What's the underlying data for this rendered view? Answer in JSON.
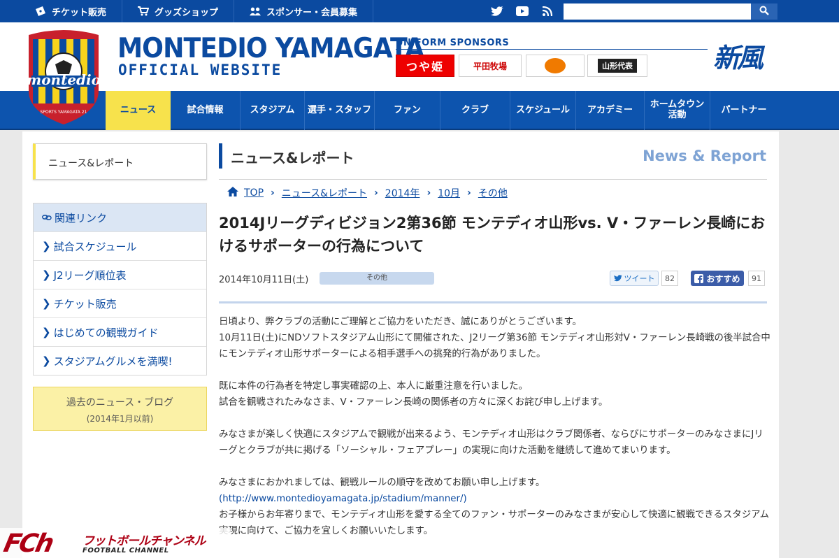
{
  "topbar": {
    "items": [
      {
        "label": "チケット販売",
        "icon": "ticket-icon"
      },
      {
        "label": "グッズショップ",
        "icon": "cart-icon"
      },
      {
        "label": "スポンサー・会員募集",
        "icon": "people-icon"
      }
    ],
    "social": [
      "twitter-icon",
      "youtube-icon",
      "rss-icon"
    ],
    "search_value": ""
  },
  "header": {
    "title": "MONTEDIO YAMAGATA",
    "subtitle": "OFFICIAL WEBSITE",
    "sponsors_heading": "UNIFORM SPONSORS",
    "sponsors": [
      "つや姫",
      "平田牧場",
      "",
      "山形代表"
    ],
    "brush_text": "新風"
  },
  "nav": {
    "items": [
      "ニュース",
      "試合情報",
      "スタジアム",
      "選手・スタッフ",
      "ファン",
      "クラブ",
      "スケジュール",
      "アカデミー",
      "ホームタウン\n活動",
      "パートナー"
    ]
  },
  "sidebar": {
    "active": "ニュース&レポート",
    "links_heading": "関連リンク",
    "links": [
      "試合スケジュール",
      "J2リーグ順位表",
      "チケット販売",
      "はじめての観戦ガイド",
      "スタジアムグルメを満喫!"
    ],
    "archive_line1": "過去のニュース・ブログ",
    "archive_line2": "(2014年1月以前)"
  },
  "section": {
    "title": "ニュース&レポート",
    "title_en": "News & Report"
  },
  "breadcrumb": [
    "TOP",
    "ニュース&レポート",
    "2014年",
    "10月",
    "その他"
  ],
  "article": {
    "title": "2014Jリーグディビジョン2第36節 モンテディオ山形vs. V・ファーレン長崎におけるサポーターの行為について",
    "date": "2014年10月11日(土)",
    "category": "その他",
    "tweet_label": "ツイート",
    "tweet_count": "82",
    "fb_label": "おすすめ",
    "fb_count": "91",
    "p1": "日頃より、弊クラブの活動にご理解とご協力をいただき、誠にありがとうございます。\n10月11日(土)にNDソフトスタジアム山形にて開催された、J2リーグ第36節 モンテディオ山形対V・ファーレン長崎戦の後半試合中にモンテディオ山形サポーターによる相手選手への挑発的行為がありました。",
    "p2": "既に本件の行為者を特定し事実確認の上、本人に厳重注意を行いました。\n試合を観戦されたみなさま、V・ファーレン長崎の関係者の方々に深くお詫び申し上げます。",
    "p3": "みなさまが楽しく快適にスタジアムで観戦が出来るよう、モンテディオ山形はクラブ関係者、ならびにサポーターのみなさまにJリーグとクラブが共に掲げる「ソーシャル・フェアプレー」の実現に向けた活動を継続して進めてまいります。",
    "p4": "みなさまにおかれましては、観戦ルールの順守を改めてお願い申し上げます。",
    "p4_link": "(http://www.montedioyamagata.jp/stadium/manner/)",
    "p5": "お子様からお年寄りまで、モンテディオ山形を愛する全てのファン・サポーターのみなさまが安心して快適に観戦できるスタジアム実現に向けて、ご協力を宜しくお願いいたします。"
  },
  "watermark": {
    "logo": "FCh",
    "jp": "フットボールチャンネル",
    "en": "FOOTBALL CHANNEL"
  },
  "colors": {
    "brand_blue": "#0b4aa0",
    "nav_active": "#f7e24c",
    "accent_red": "#ad0014"
  }
}
